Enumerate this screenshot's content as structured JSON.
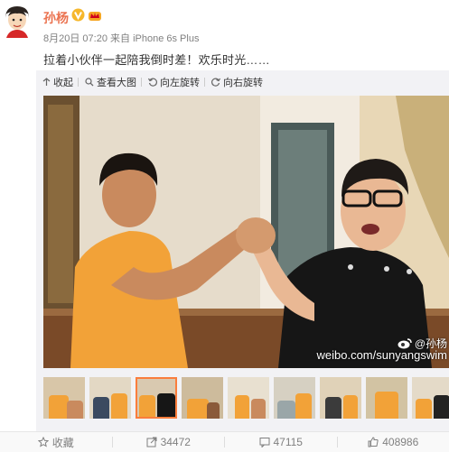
{
  "author": {
    "name": "孙杨",
    "verified_icon": "vip-v-icon",
    "member_icon": "crown-icon"
  },
  "meta": {
    "time": "8月20日 07:20",
    "source_prefix": "来自",
    "device": "iPhone 6s Plus"
  },
  "post": {
    "text": "拉着小伙伴一起陪我倒时差！欢乐时光……"
  },
  "media_toolbar": {
    "collapse": "收起",
    "view_large": "查看大图",
    "rotate_left": "向左旋转",
    "rotate_right": "向右旋转"
  },
  "photo": {
    "watermark_brand": "@孙杨",
    "watermark_url": "weibo.com/sunyangswim"
  },
  "thumbnails": {
    "count": 9,
    "selected_index": 2
  },
  "actions": {
    "favorite": "收藏",
    "repost_count": "34472",
    "comment_count": "47115",
    "like_count": "408986"
  },
  "colors": {
    "accent": "#eb7350",
    "selected_thumb": "#fa7d3c",
    "vip": "#f6b72b"
  }
}
